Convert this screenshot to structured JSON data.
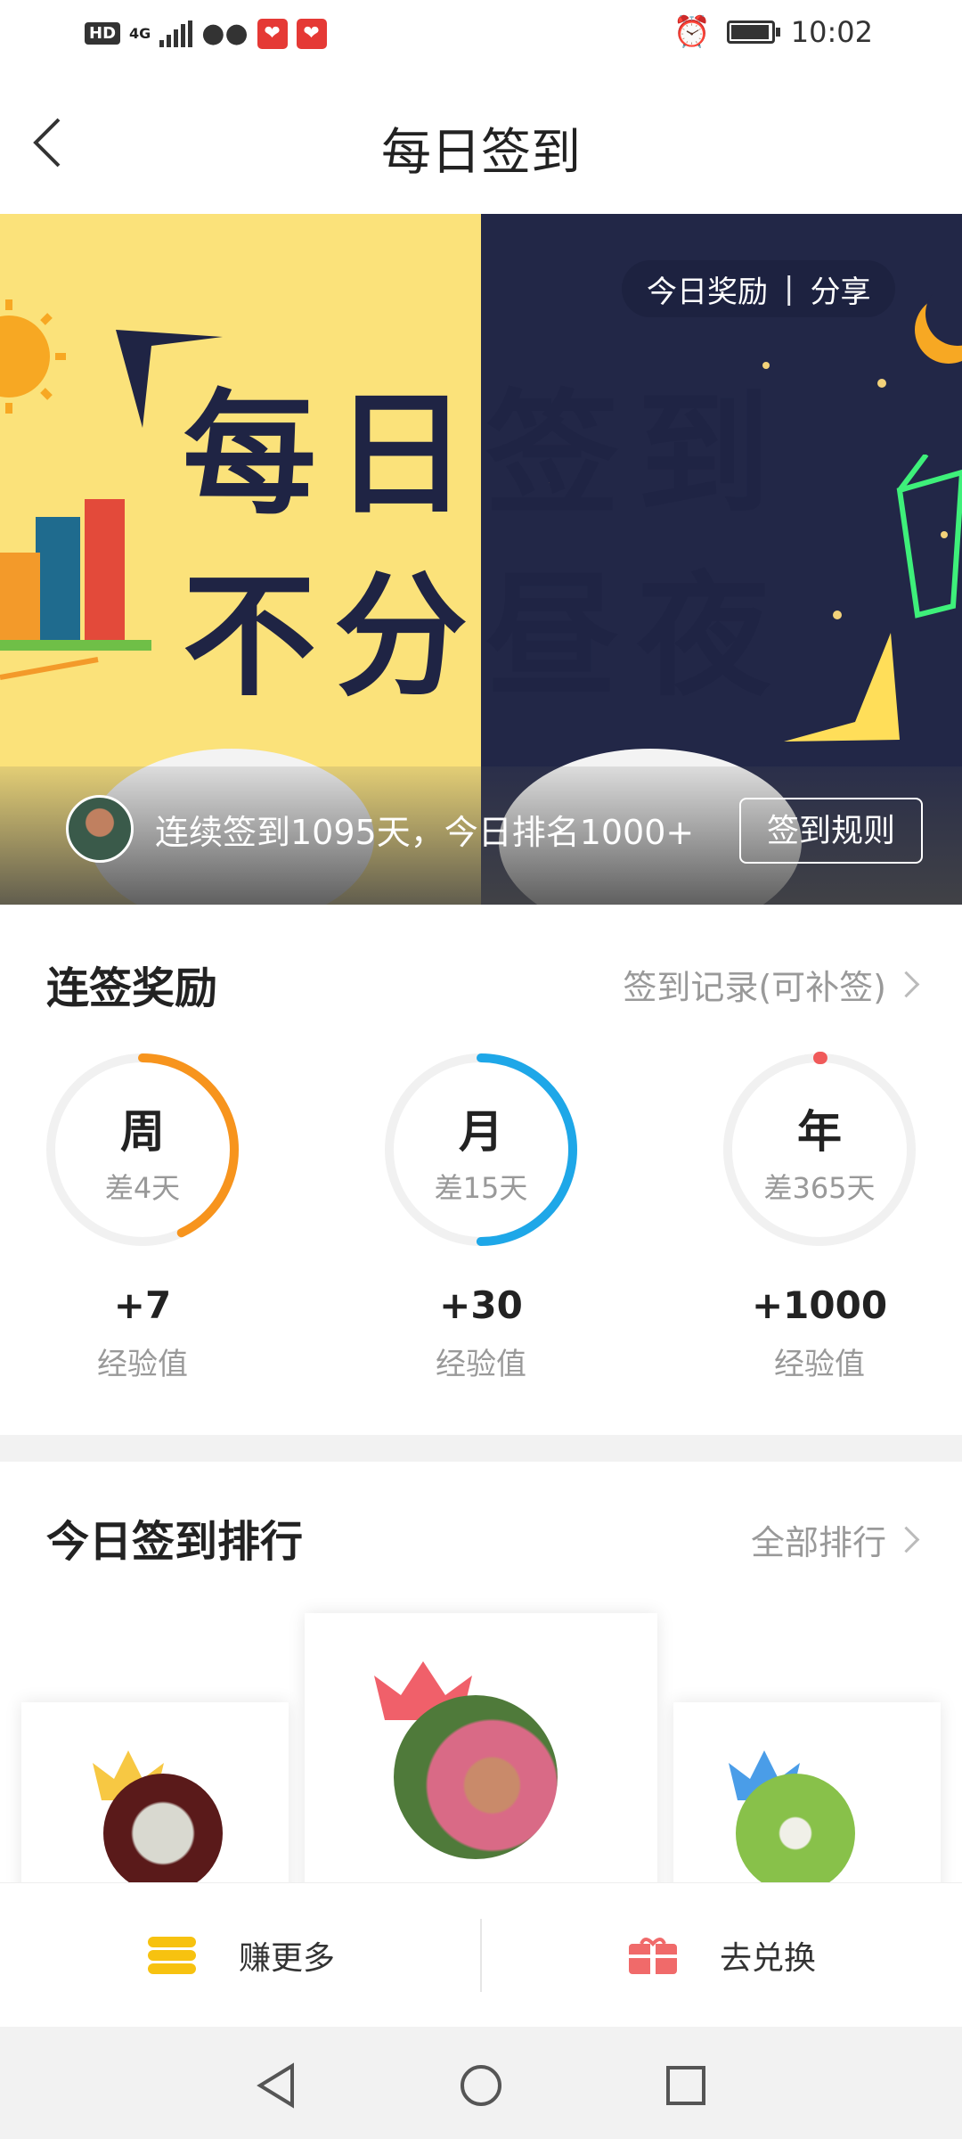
{
  "status_bar": {
    "hd": "HD",
    "network": "4G",
    "time": "10:02"
  },
  "header": {
    "title": "每日签到"
  },
  "banner": {
    "headline_line1": "每日签到",
    "headline_line2": "不分昼夜",
    "reward_link": "今日奖励",
    "separator": "|",
    "share_link": "分享",
    "streak_text": "连续签到1095天，今日排名1000+",
    "rules_button": "签到规则"
  },
  "streak_rewards": {
    "title": "连签奖励",
    "record_link": "签到记录(可补签)",
    "items": [
      {
        "label": "周",
        "remaining": "差4天",
        "points": "+7",
        "unit": "经验值",
        "progress": 0.43,
        "color": "#f7941d"
      },
      {
        "label": "月",
        "remaining": "差15天",
        "points": "+30",
        "unit": "经验值",
        "progress": 0.5,
        "color": "#1ea7e8"
      },
      {
        "label": "年",
        "remaining": "差365天",
        "points": "+1000",
        "unit": "经验值",
        "progress": 0.003,
        "color": "#f05a5a"
      }
    ]
  },
  "ranking": {
    "title": "今日签到排行",
    "all_link": "全部排行"
  },
  "bottom_bar": {
    "earn_label": "赚更多",
    "redeem_label": "去兑换"
  },
  "colors": {
    "gold": "#f7c843",
    "silver_blue": "#4a9de8",
    "rank_first": "#f0606a",
    "earn_icon": "#f7c210",
    "redeem_icon": "#f06a6a"
  }
}
